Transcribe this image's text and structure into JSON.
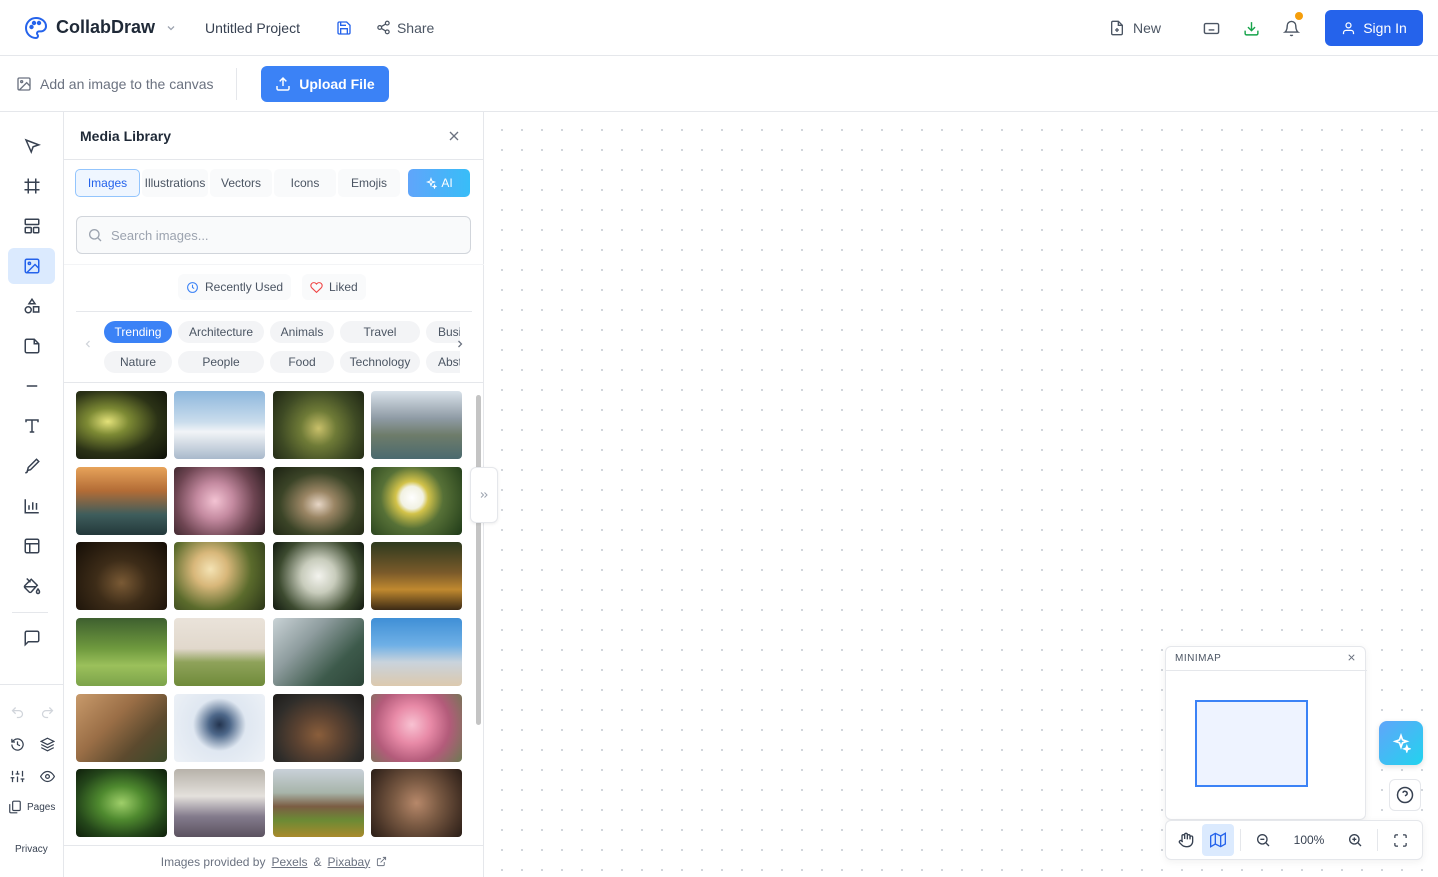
{
  "app": {
    "name": "CollabDraw",
    "project_title": "Untitled Project"
  },
  "header": {
    "share_label": "Share",
    "new_label": "New",
    "signin_label": "Sign In"
  },
  "subbar": {
    "hint": "Add an image to the canvas",
    "upload_label": "Upload File"
  },
  "sidebar": {
    "pages_label": "Pages",
    "privacy_label": "Privacy"
  },
  "media": {
    "title": "Media Library",
    "tabs": [
      "Images",
      "Illustrations",
      "Vectors",
      "Icons",
      "Emojis",
      "AI"
    ],
    "active_tab": "Images",
    "search_placeholder": "Search images...",
    "recent_label": "Recently Used",
    "liked_label": "Liked",
    "categories_row1": [
      "Trending",
      "Architecture",
      "Animals",
      "Travel",
      "Business"
    ],
    "categories_row2": [
      "Nature",
      "People",
      "Food",
      "Technology",
      "Abstract"
    ],
    "active_category": "Trending",
    "footer_prefix": "Images provided by",
    "footer_and": "&",
    "provider1": "Pexels",
    "provider2": "Pixabay"
  },
  "minimap": {
    "title": "MINIMAP"
  },
  "zoom": {
    "level": "100%"
  },
  "colors": {
    "primary": "#2563eb",
    "accent": "#3b82f6",
    "notification": "#f59e0b"
  }
}
